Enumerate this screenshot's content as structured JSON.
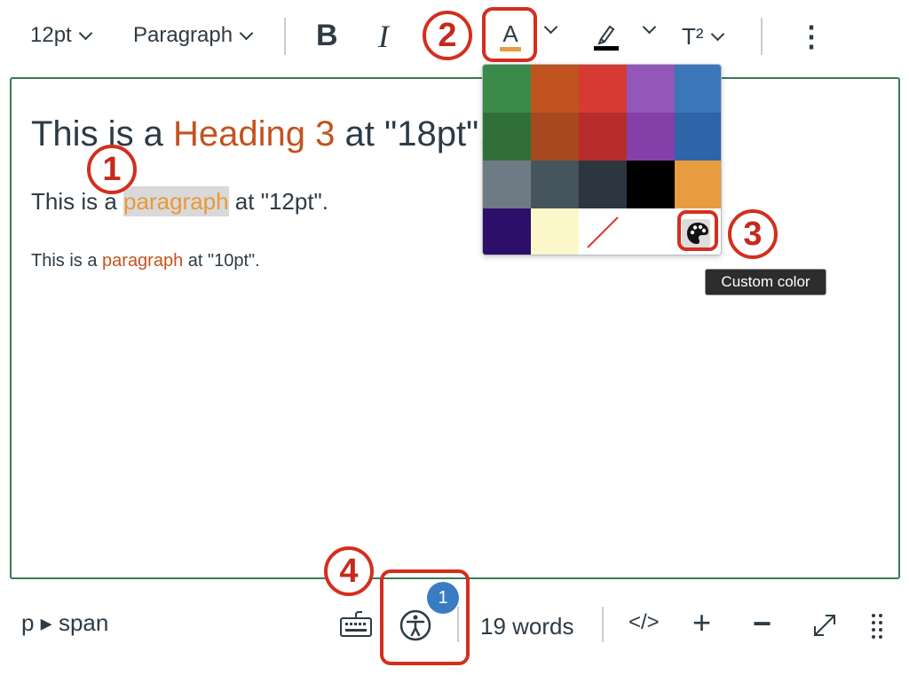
{
  "toolbar": {
    "font_size": "12pt",
    "block_format": "Paragraph",
    "bold_label": "B",
    "italic_label": "I",
    "text_color_label": "A",
    "superscript_label": "T²",
    "more_label": "⋮"
  },
  "editor": {
    "heading": {
      "prefix": "This is a ",
      "highlight": "Heading 3",
      "suffix": " at \"18pt\"."
    },
    "para12": {
      "prefix": "This is a ",
      "highlight": "paragraph",
      "suffix": " at \"12pt\"."
    },
    "para10": {
      "prefix": "This is a ",
      "highlight": "paragraph",
      "suffix": " at \"10pt\"."
    }
  },
  "palette": {
    "colors": [
      [
        "#3a8a4a",
        "#c0531f",
        "#d63a33",
        "#9257b8",
        "#3b76b8"
      ],
      [
        "#307038",
        "#a84820",
        "#b82c2c",
        "#8440a8",
        "#2e64a8"
      ],
      [
        "#6e7a84",
        "#46545e",
        "#2d3540",
        "#000000",
        "#e89c40"
      ],
      [
        "#2b0f6a",
        "#fcf7c8",
        "none",
        "#ffffff",
        "custom"
      ]
    ],
    "custom_tooltip": "Custom color"
  },
  "annotations": [
    "1",
    "2",
    "3",
    "4"
  ],
  "status": {
    "path": "p ▸ span",
    "a11y_badge": "1",
    "word_count": "19 words",
    "html_label": "</>",
    "plus_label": "+",
    "minus_label": "−"
  },
  "accent": "#d42e1f"
}
